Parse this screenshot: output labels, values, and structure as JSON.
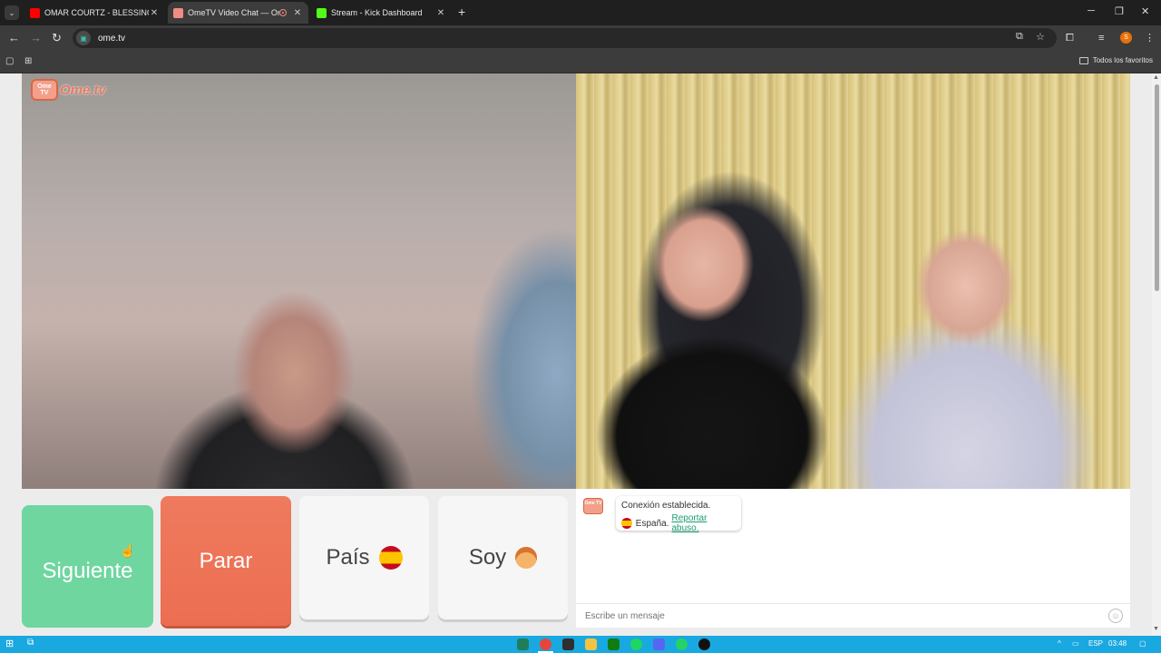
{
  "browser": {
    "tabs": [
      {
        "title": "OMAR COURTZ - BLESSINGS (V",
        "favicon_color": "#ff0000",
        "active": false
      },
      {
        "title": "OmeTV Video Chat — Ome",
        "favicon_color": "#f28b82",
        "active": true
      },
      {
        "title": "Stream - Kick Dashboard",
        "favicon_color": "#53fc18",
        "active": false
      }
    ],
    "tab_list_icon": "chevron-down",
    "new_tab_label": "+",
    "url": "ome.tv",
    "bookmarks_all_label": "Todos los favoritos",
    "profile_initial": "S"
  },
  "app": {
    "logo_box_text": "Ome TV",
    "logo_text": "Ome.tv",
    "buttons": {
      "next": "Siguiente",
      "stop": "Parar",
      "country": "País",
      "gender": "Soy"
    },
    "chat": {
      "status": "Conexión establecida.",
      "country": "España.",
      "report_link": "Reportar abuso.",
      "input_placeholder": "Escribe un mensaje"
    }
  },
  "taskbar": {
    "lang": "ESP",
    "time": "03:48",
    "accent": "#1aa8e0"
  }
}
